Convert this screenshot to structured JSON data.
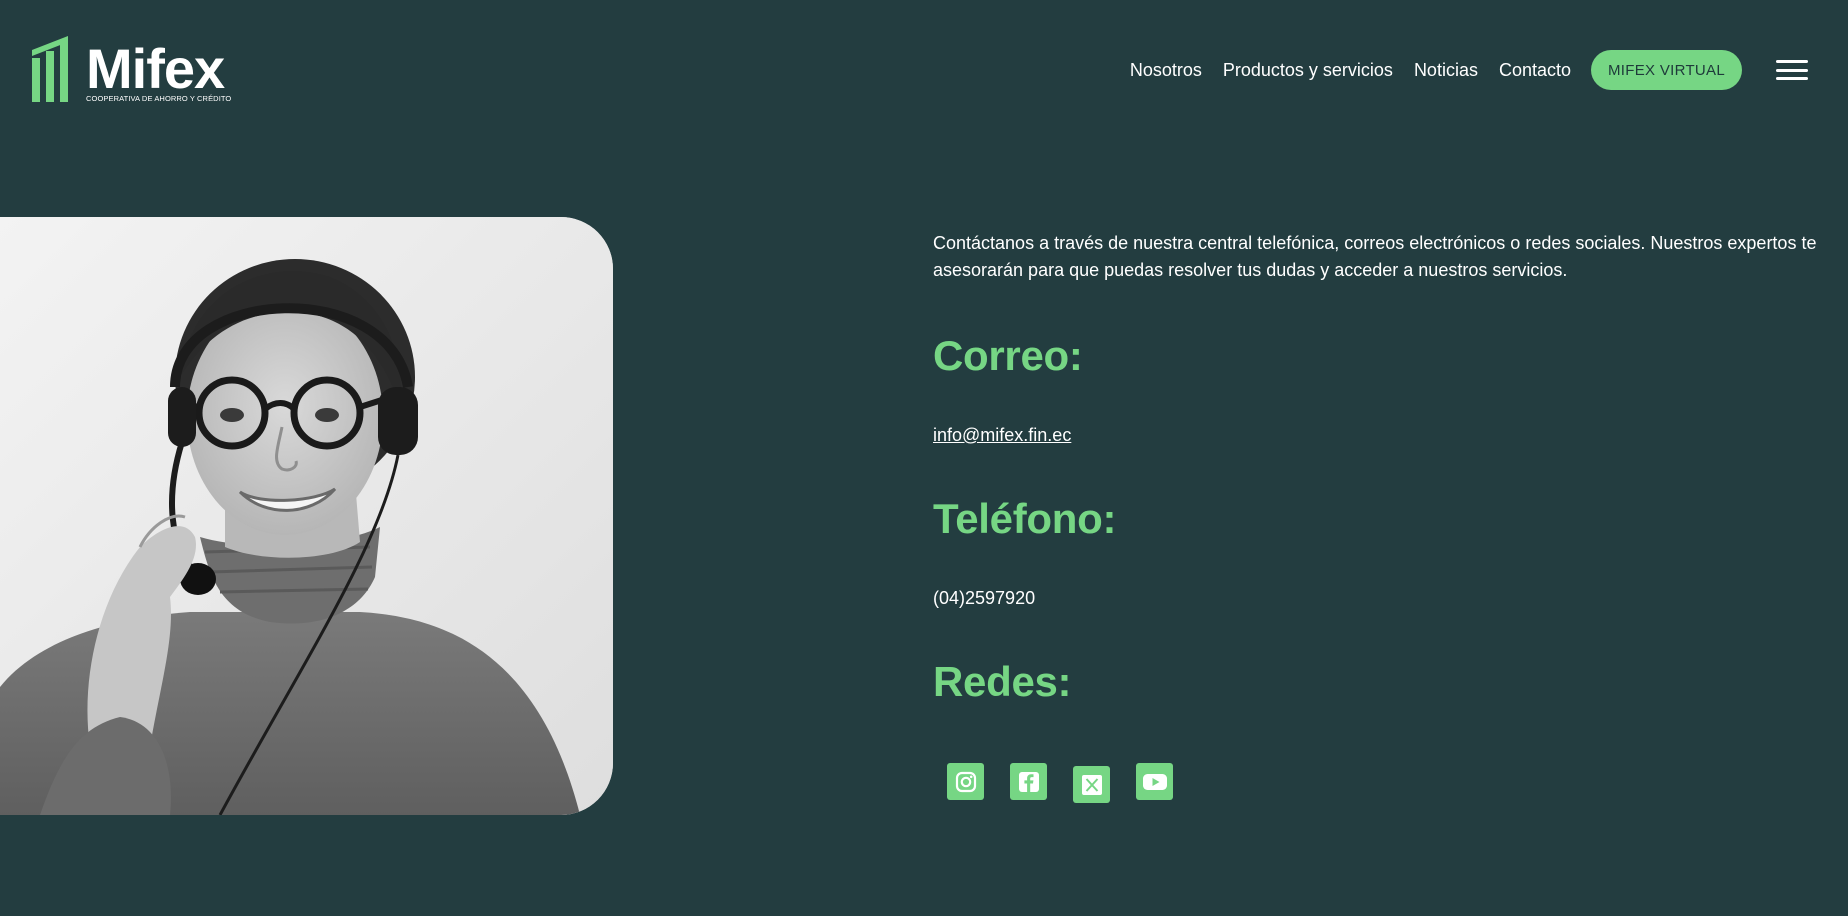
{
  "brand": {
    "name": "Mifex",
    "tagline": "COOPERATIVA DE AHORRO Y CRÉDITO",
    "accent_color": "#76d684",
    "background_color": "#233d40"
  },
  "nav": {
    "items": [
      {
        "label": "Nosotros"
      },
      {
        "label": "Productos y servicios"
      },
      {
        "label": "Noticias"
      },
      {
        "label": "Contacto"
      }
    ],
    "cta_label": "MIFEX VIRTUAL",
    "menu_icon": "hamburger-menu-icon"
  },
  "photo": {
    "subject": "Woman with headset smiling (black and white)"
  },
  "contact": {
    "intro": "Contáctanos a través de nuestra central telefónica, correos electrónicos o redes sociales. Nuestros expertos te asesorarán para que puedas resolver tus dudas y acceder a nuestros servicios.",
    "email_heading": "Correo:",
    "email": "info@mifex.fin.ec",
    "phone_heading": "Teléfono:",
    "phone": "(04)2597920",
    "social_heading": "Redes:",
    "social_icons": [
      "instagram-icon",
      "facebook-icon",
      "x-twitter-icon",
      "youtube-icon"
    ]
  }
}
